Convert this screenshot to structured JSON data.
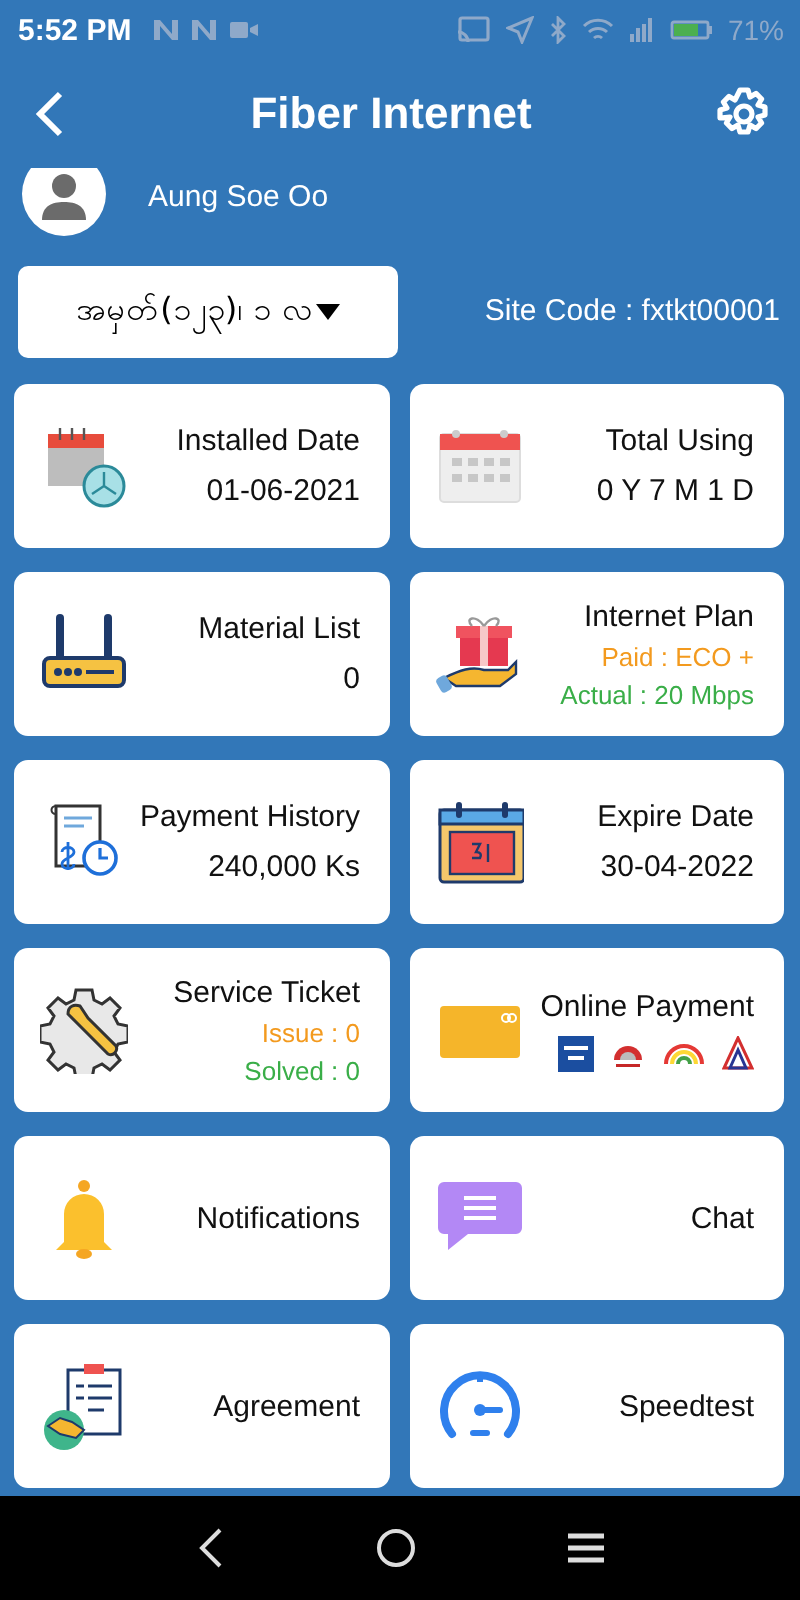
{
  "status_bar": {
    "time": "5:52 PM",
    "battery": "71%"
  },
  "header": {
    "title": "Fiber Internet"
  },
  "user": {
    "name": "Aung Soe Oo"
  },
  "selector": {
    "value": "အမှတ်(၁၂၃)၊ ၁ လ"
  },
  "site_code": "Site Code : fxtkt00001",
  "cards": [
    {
      "title": "Installed Date",
      "lines": [
        {
          "text": "01-06-2021",
          "color": "#111111"
        }
      ]
    },
    {
      "title": "Total Using",
      "lines": [
        {
          "text": "0 Y 7 M 1 D",
          "color": "#111111"
        }
      ]
    },
    {
      "title": "Material List",
      "lines": [
        {
          "text": "0",
          "color": "#111111"
        }
      ]
    },
    {
      "title": "Internet Plan",
      "lines": [
        {
          "text": "Paid : ECO +",
          "color": "#f39a1e"
        },
        {
          "text": "Actual : 20 Mbps",
          "color": "#3aae48"
        }
      ]
    },
    {
      "title": "Payment History",
      "lines": [
        {
          "text": "240,000 Ks",
          "color": "#111111"
        }
      ]
    },
    {
      "title": "Expire Date",
      "lines": [
        {
          "text": "30-04-2022",
          "color": "#111111"
        }
      ]
    },
    {
      "title": "Service Ticket",
      "lines": [
        {
          "text": "Issue : 0",
          "color": "#f39a1e"
        },
        {
          "text": "Solved : 0",
          "color": "#3aae48"
        }
      ]
    },
    {
      "title": "Online Payment"
    },
    {
      "title": "Notifications"
    },
    {
      "title": "Chat"
    },
    {
      "title": "Agreement"
    },
    {
      "title": "Speedtest"
    }
  ]
}
